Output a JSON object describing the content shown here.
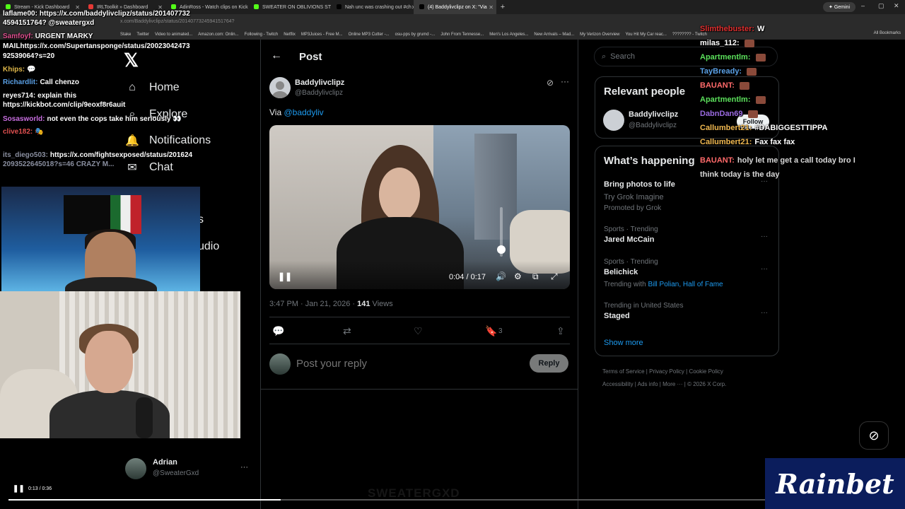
{
  "browser": {
    "tabs": [
      {
        "label": "Stream - Kick Dashboard",
        "color": "#53fc18"
      },
      {
        "label": "IRLToolkit » Dashboard",
        "color": "#e53935"
      },
      {
        "label": "AdinRoss - Watch clips on Kick",
        "color": "#53fc18"
      },
      {
        "label": "SWEATER ON OBLIVIONS STRE",
        "color": "#53fc18"
      },
      {
        "label": "Nah unc was crashing out #ch",
        "color": "#000000"
      },
      {
        "label": "(4) Baddylivclipz on X: \"Via",
        "color": "#000000"
      }
    ],
    "new_tab": "+",
    "gemini_label": "✦ Gemini",
    "url": "x.com/Baddylivclipz/status/2014077324594151764?",
    "bookmarks": [
      "Stake",
      "Twitter",
      "Video to animated...",
      "Amazon.com: Onlin...",
      "Following - Twitch",
      "Netflix",
      "MP3Juices - Free M...",
      "Online MP3 Cutter -...",
      "osu-pps by grumd -...",
      "John From Tennesse...",
      "Men's Los Angeles...",
      "New Arrivals – Mad...",
      "My Verizon Overview",
      "You Hit My Car reac...",
      "???????? - Twitch"
    ],
    "all_bookmarks": "All Bookmarks"
  },
  "nav": {
    "items": [
      {
        "label": "Home",
        "icon": "home-icon",
        "glyph": "⌂"
      },
      {
        "label": "Explore",
        "icon": "search-icon",
        "glyph": "⌕"
      },
      {
        "label": "Notifications",
        "icon": "bell-icon",
        "glyph": "🔔"
      },
      {
        "label": "Chat",
        "icon": "chat-icon",
        "glyph": "✉"
      }
    ],
    "partial_items": [
      "s",
      "udio"
    ]
  },
  "post": {
    "header_title": "Post",
    "author_name": "Baddylivclipz",
    "author_handle": "@Baddylivclipz",
    "body_prefix": "Via ",
    "body_mention": "@baddyliv",
    "video_time": "0:04 / 0:17",
    "timestamp": "3:47 PM · Jan 21, 2026 · ",
    "views_count": "141",
    "views_label": " Views",
    "bookmark_count": "3",
    "reply_placeholder": "Post your reply",
    "reply_button": "Reply"
  },
  "sidebar": {
    "search_placeholder": "Search",
    "relevant_title": "Relevant people",
    "relevant_name": "Baddylivclipz",
    "relevant_handle": "@Baddylivclipz",
    "follow_label": "Follow",
    "happening_title": "What’s happening",
    "trends": [
      {
        "context": "",
        "title": "Bring photos to life",
        "sub1": "Try Grok Imagine",
        "sub2": "Promoted by Grok"
      },
      {
        "context": "Sports · Trending",
        "title": "Jared McCain",
        "sub1": "",
        "sub2": ""
      },
      {
        "context": "Sports · Trending",
        "title": "Belichick",
        "sub1": "Trending with ",
        "sub2": "Bill Polian, Hall of Fame"
      },
      {
        "context": "Trending in United States",
        "title": "Staged",
        "sub1": "",
        "sub2": ""
      }
    ],
    "show_more": "Show more",
    "footer_row1": [
      "Terms of Service",
      "Privacy Policy",
      "Cookie Policy"
    ],
    "footer_row2": [
      "Accessibility",
      "Ads info",
      "More ···",
      "© 2026 X Corp."
    ]
  },
  "chat_left": [
    {
      "user": "laflame00:",
      "color": "#ffffff",
      "text": "https://x.com/baddylivclipz/status/201407732"
    },
    {
      "user": "",
      "color": "#ffffff",
      "text": "4594151764? @sweatergxd"
    },
    {
      "user": "Samfoyf:",
      "color": "#e05090",
      "text": "URGENT MARKY"
    },
    {
      "user": "",
      "color": "#ffffff",
      "text": "MAILhttps://x.com/Supertansponge/status/20023042473"
    },
    {
      "user": "",
      "color": "#ffffff",
      "text": "92539064?s=20"
    },
    {
      "user": "Khips:",
      "color": "#e0b84a",
      "text": "💬"
    },
    {
      "user": "Richardlit:",
      "color": "#5aa0e6",
      "text": "Call chenzo"
    },
    {
      "user": "reyes714:",
      "color": "#ffffff",
      "text": "explain this"
    },
    {
      "user": "",
      "color": "#ffffff",
      "text": "https://kickbot.com/clip/9eoxf8r6auit"
    },
    {
      "user": "Sosasworld:",
      "color": "#c86ee0",
      "text": "not even the cops take him seriously 👀"
    },
    {
      "user": "clive182:",
      "color": "#e05050",
      "text": "🎭"
    },
    {
      "user": "its_diego503:",
      "color": "#8a8fa0",
      "text": "https://x.com/fightsexposed/status/201624"
    },
    {
      "user": "",
      "color": "#8a8fa0",
      "text": "2093522645018?s=46 CRAZY M..."
    }
  ],
  "chat_right": [
    {
      "user": "Slimthebuster:",
      "color": "#e03030",
      "text": "W",
      "emote": false
    },
    {
      "user": "milas_112:",
      "color": "#ffffff",
      "text": "",
      "emote": true
    },
    {
      "user": "Apartmentlm:",
      "color": "#5be05b",
      "text": "",
      "emote": true
    },
    {
      "user": "TayBready:",
      "color": "#5aa0e6",
      "text": "",
      "emote": true
    },
    {
      "user": "BAUANT:",
      "color": "#ff6a6a",
      "text": "",
      "emote": true
    },
    {
      "user": "Apartmentlm:",
      "color": "#5be05b",
      "text": "",
      "emote": true
    },
    {
      "user": "DabnDan69",
      "color": "#9a6ae0",
      "text": "",
      "emote": true
    },
    {
      "user": "Callumbert21:",
      "color": "#f0b850",
      "text": "#DABIGGESTTIPPA",
      "emote": false
    },
    {
      "user": "Callumbert21:",
      "color": "#f0b850",
      "text": "Fax fax fax",
      "emote": false
    },
    {
      "user": "BAUANT:",
      "color": "#ff6a6a",
      "text": "holy let me get a call today bro I",
      "emote": false
    },
    {
      "user": "",
      "color": "#ff6a6a",
      "text": "think today is the day",
      "emote": false
    }
  ],
  "account": {
    "name": "Adrian",
    "handle": "@SweaterGxd"
  },
  "player": {
    "time": "0:13 / 0:36",
    "progress": 0.36,
    "watermark": "SWEATERGXD"
  },
  "sponsor": {
    "label": "Rainbet"
  }
}
